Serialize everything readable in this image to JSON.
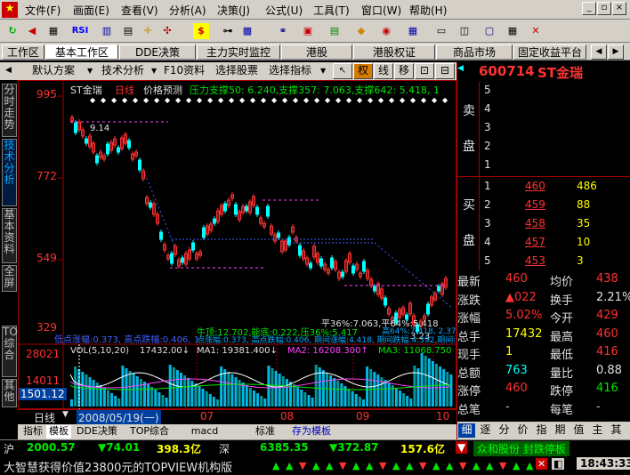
{
  "menu": {
    "items": [
      "文件(F)",
      "画面(E)",
      "查看(V)",
      "分析(A)",
      "决策(J)",
      "公式(U)",
      "工具(T)",
      "窗口(W)",
      "帮助(H)"
    ]
  },
  "toolbar": {
    "icons": [
      "refresh-icon",
      "back-icon",
      "kline-icon",
      "rsi-icon",
      "compare-icon",
      "cross-icon",
      "dollar-icon",
      "trend-icon",
      "multi-icon",
      "f10-icon",
      "news-icon",
      "news2-icon",
      "alert-icon",
      "star-icon",
      "book-icon",
      "calc-icon",
      "screen-icon",
      "layout-icon",
      "settings-icon",
      "exit-icon"
    ],
    "rsi": "RSI"
  },
  "tabs": {
    "items": [
      "工作区",
      "基本工作区",
      "DDE决策",
      "主力实时监控",
      "港股",
      "港股权证",
      "商品市场",
      "固定收益平台"
    ]
  },
  "chart_toolbar": {
    "items": [
      "默认方案",
      "技术分析",
      "F10资料",
      "选择股票",
      "选择指标"
    ],
    "btn_q": "权",
    "btn_x": "线",
    "btn_y": "移"
  },
  "left_tabs": {
    "items": [
      "分时走势",
      "技术分析",
      "基本资料",
      "全屏",
      "TOP综合",
      "其他"
    ]
  },
  "chart_header": {
    "name": "ST金瑞",
    "period": "日线",
    "price_forecast": "价格预测",
    "pressure": "压力支撑50: 6.240,支撑357: 7.063,支撑642: 5.418, 1"
  },
  "price_axis": {
    "labels": [
      "995",
      "772",
      "549",
      "329"
    ]
  },
  "annotations": {
    "high": "9.14",
    "low": "3.23",
    "swing1": "低点涨幅:0.373, 高点跌幅:0.406, 1",
    "bull": "牛顶:12.702,能底:0.222,压36%:5.417",
    "flat": "平36%:7.063,平64%:5.418",
    "right_lows": "高64%:7.418, 2.37.",
    "rebound": "点涨幅:0.373, 高点跌幅:0.406, 期间涨幅:4.418, 期间跌幅:4.392,期间涨:?"
  },
  "volume": {
    "label": "VOL(5,10,20)",
    "vol": "17432.00↓",
    "ma1": "MA1: 19381.400↓",
    "ma2": "MA2: 16208.300↑",
    "ma3": "MA3: 11068.750",
    "axis_top": "28021",
    "axis_mid": "14011",
    "cursor_value": "1501.12"
  },
  "date_bar": {
    "period": "日线",
    "date": "2008/05/19(一)",
    "months": [
      "07",
      "08",
      "09",
      "10"
    ]
  },
  "bottom_tabs": {
    "items": [
      "指标",
      "模板",
      "DDE决策",
      "TOP综合",
      "macd",
      "标准",
      "存为模板"
    ]
  },
  "status": {
    "market": "沪",
    "index": "2000.57",
    "change": "▼74.01",
    "amount": "398.3亿",
    "market2": "深",
    "index2": "6385.35",
    "change2": "▼372.87",
    "amount2": "157.6亿",
    "news": "众和股份 封跌停板"
  },
  "ticker": {
    "text": "大智慧获得价值23800元的TOPVIEW机构版",
    "time": "18:43:33"
  },
  "quote": {
    "code": "600714",
    "name": "ST金瑞",
    "sell_label": [
      "卖",
      "盘"
    ],
    "buy_label": [
      "买",
      "盘"
    ],
    "sell": [
      {
        "n": "5",
        "p": "",
        "v": ""
      },
      {
        "n": "4",
        "p": "",
        "v": ""
      },
      {
        "n": "3",
        "p": "",
        "v": ""
      },
      {
        "n": "2",
        "p": "",
        "v": ""
      },
      {
        "n": "1",
        "p": "",
        "v": ""
      }
    ],
    "buy": [
      {
        "n": "1",
        "p": "460",
        "v": "486"
      },
      {
        "n": "2",
        "p": "459",
        "v": "88"
      },
      {
        "n": "3",
        "p": "458",
        "v": "35"
      },
      {
        "n": "4",
        "p": "457",
        "v": "10"
      },
      {
        "n": "5",
        "p": "453",
        "v": "3"
      }
    ],
    "stats": [
      {
        "l1": "最新",
        "v1": "460",
        "l2": "均价",
        "v2": "438"
      },
      {
        "l1": "涨跌",
        "v1": "▲022",
        "l2": "换手",
        "v2": "2.21%"
      },
      {
        "l1": "涨幅",
        "v1": "5.02%",
        "l2": "今开",
        "v2": "429"
      },
      {
        "l1": "总手",
        "v1": "17432",
        "l2": "最高",
        "v2": "460"
      },
      {
        "l1": "现手",
        "v1": "1",
        "l2": "最低",
        "v2": "416"
      },
      {
        "l1": "总额",
        "v1": "763",
        "l2": "量比",
        "v2": "0.88"
      },
      {
        "l1": "涨停",
        "v1": "460",
        "l2": "跌停",
        "v2": "416"
      },
      {
        "l1": "总笔",
        "v1": "-",
        "l2": "每笔",
        "v2": "-"
      }
    ],
    "bottom_tabs": [
      "细",
      "逐",
      "分",
      "价",
      "指",
      "期",
      "值",
      "主",
      "其"
    ]
  }
}
